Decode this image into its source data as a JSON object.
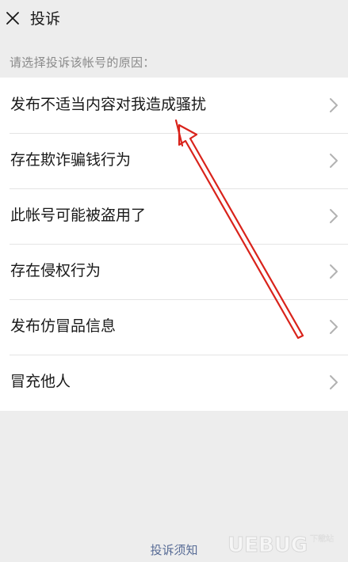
{
  "header": {
    "close_icon": "close-icon",
    "title": "投诉"
  },
  "prompt": "请选择投诉该帐号的原因：",
  "reasons": [
    {
      "label": "发布不适当内容对我造成骚扰"
    },
    {
      "label": "存在欺诈骗钱行为"
    },
    {
      "label": "此帐号可能被盗用了"
    },
    {
      "label": "存在侵权行为"
    },
    {
      "label": "发布仿冒品信息"
    },
    {
      "label": "冒充他人"
    }
  ],
  "footer": {
    "link_label": "投诉须知"
  },
  "watermark": {
    "brand": "UEBUG",
    "sub": "下载站"
  },
  "colors": {
    "background": "#ededed",
    "list_background": "#ffffff",
    "link": "#576b95",
    "annotation_arrow": "#d9231b"
  }
}
